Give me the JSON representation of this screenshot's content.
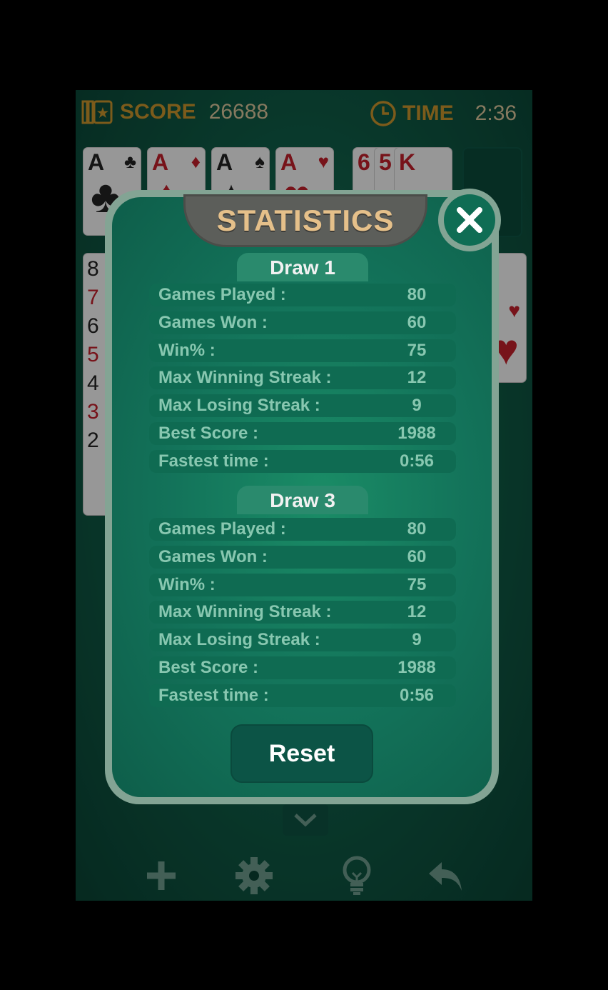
{
  "hud": {
    "score_label": "SCORE",
    "score_value": "26688",
    "time_label": "TIME",
    "time_value": "2:36"
  },
  "foundation": [
    {
      "rank": "A",
      "suit": "♣",
      "color": "black"
    },
    {
      "rank": "A",
      "suit": "♦",
      "color": "red"
    },
    {
      "rank": "A",
      "suit": "♠",
      "color": "black"
    },
    {
      "rank": "A",
      "suit": "♥",
      "color": "red"
    }
  ],
  "waste": [
    "6",
    "5",
    "K"
  ],
  "tableau_visible_ranks": [
    "8",
    "7",
    "6",
    "5",
    "4",
    "3",
    "2"
  ],
  "toolbar": {
    "icons": [
      "plus-icon",
      "gear-icon",
      "lightbulb-icon",
      "undo-icon"
    ]
  },
  "modal": {
    "title": "STATISTICS",
    "close_icon": "close-icon",
    "sections": [
      {
        "heading": "Draw 1",
        "rows": [
          {
            "label": "Games Played :",
            "value": "80"
          },
          {
            "label": "Games Won :",
            "value": "60"
          },
          {
            "label": "Win% :",
            "value": "75"
          },
          {
            "label": "Max Winning Streak :",
            "value": "12"
          },
          {
            "label": "Max Losing Streak :",
            "value": "9"
          },
          {
            "label": "Best Score :",
            "value": "1988"
          },
          {
            "label": "Fastest time :",
            "value": "0:56"
          }
        ]
      },
      {
        "heading": "Draw 3",
        "rows": [
          {
            "label": "Games Played :",
            "value": "80"
          },
          {
            "label": "Games Won :",
            "value": "60"
          },
          {
            "label": "Win% :",
            "value": "75"
          },
          {
            "label": "Max Winning Streak :",
            "value": "12"
          },
          {
            "label": "Max Losing Streak :",
            "value": "9"
          },
          {
            "label": "Best Score :",
            "value": "1988"
          },
          {
            "label": "Fastest time :",
            "value": "0:56"
          }
        ]
      }
    ],
    "reset_label": "Reset"
  },
  "colors": {
    "felt": "#13735a",
    "frame": "#83a494",
    "gold": "#c8932c",
    "title": "#e5c08a",
    "row_text": "#88c7b0"
  }
}
